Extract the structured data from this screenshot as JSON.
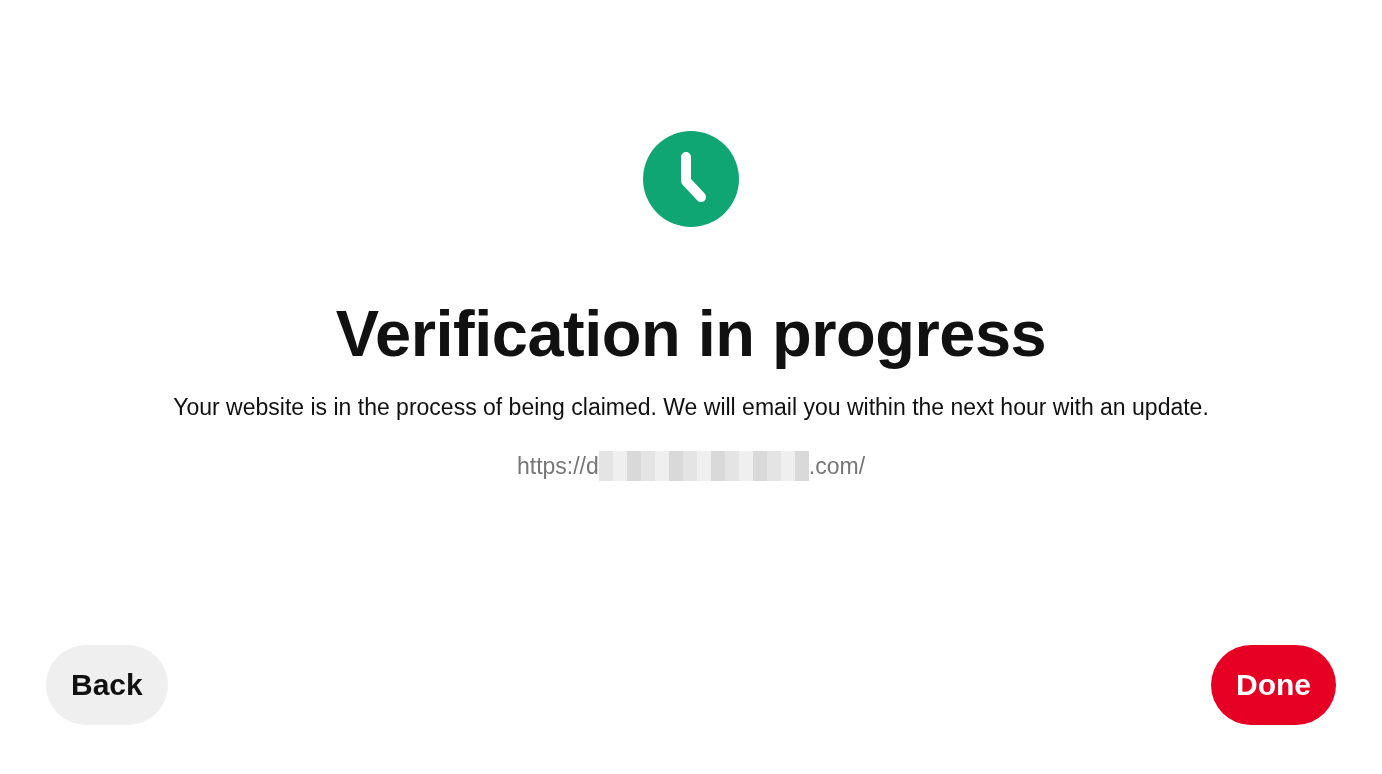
{
  "status": {
    "title": "Verification in progress",
    "message": "Your website is in the process of being claimed. We will email you within the next hour with an update."
  },
  "url": {
    "prefix": "https://d",
    "redacted": true,
    "suffix": ".com/"
  },
  "buttons": [
    {
      "label": "Back",
      "kind": "secondary"
    },
    {
      "label": "Done",
      "kind": "primary"
    }
  ]
}
